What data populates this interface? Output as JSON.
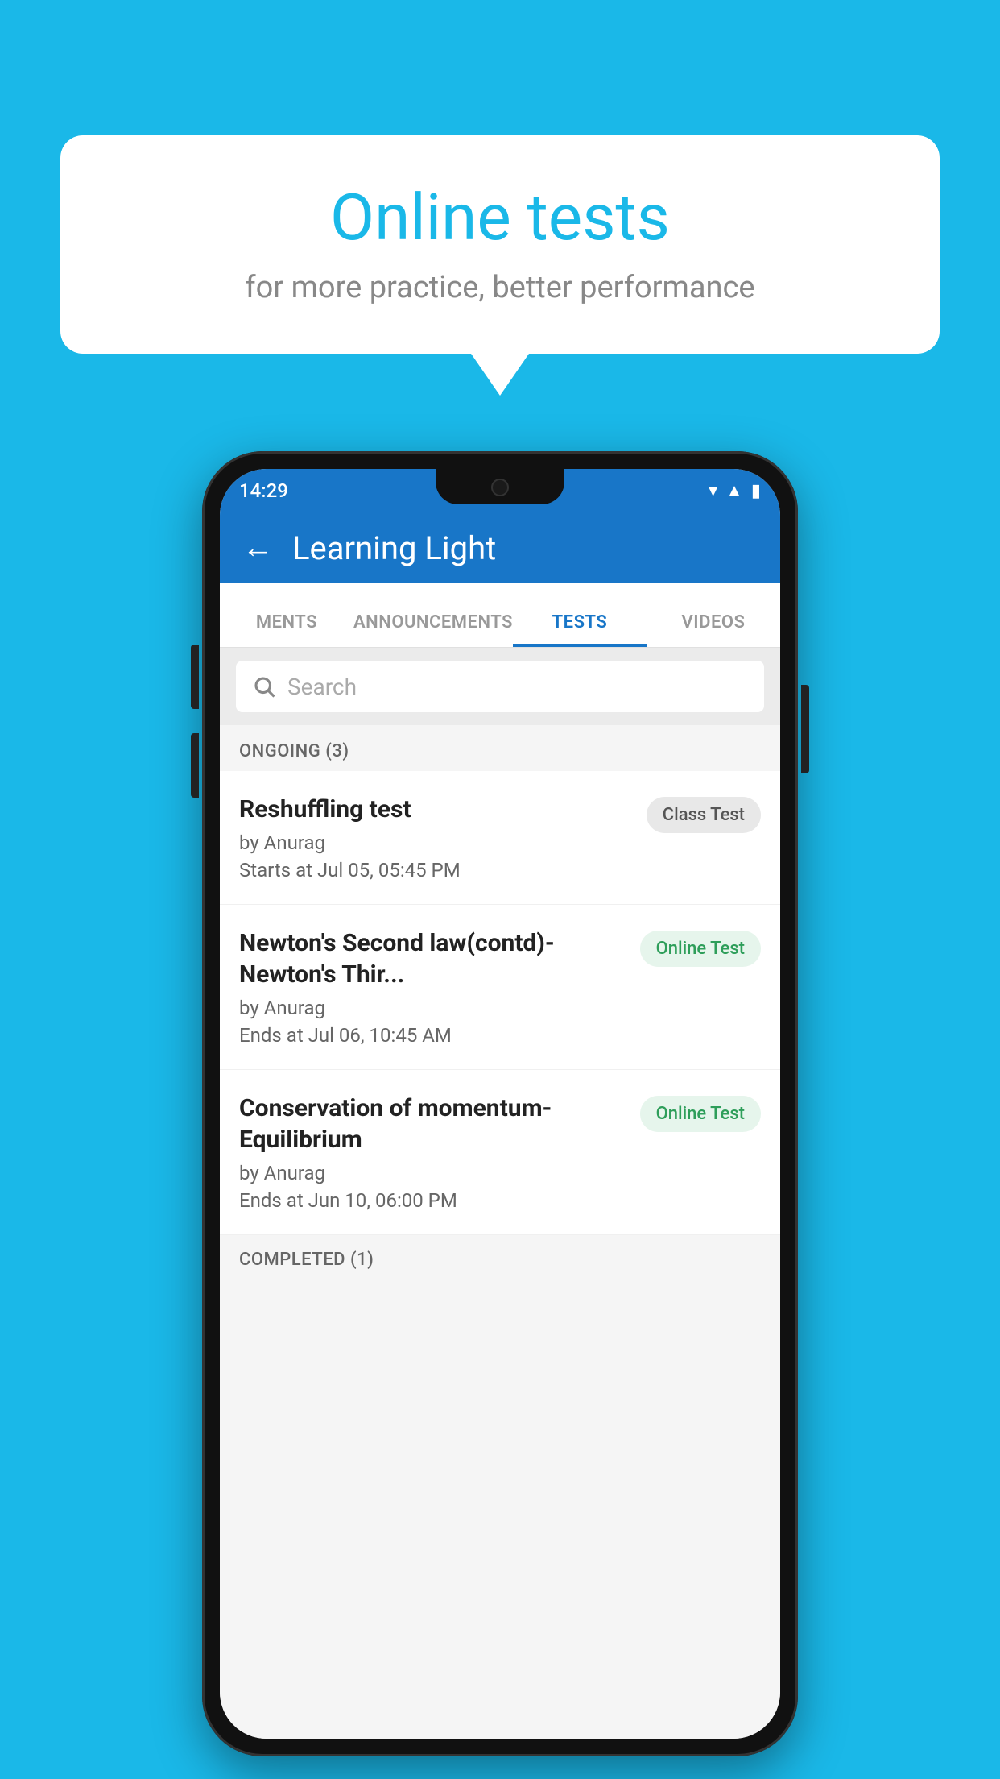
{
  "background_color": "#1ab8e8",
  "bubble": {
    "title": "Online tests",
    "subtitle": "for more practice, better performance"
  },
  "phone": {
    "status_bar": {
      "time": "14:29",
      "icons": [
        "wifi",
        "signal",
        "battery"
      ]
    },
    "app_bar": {
      "title": "Learning Light",
      "back_label": "←"
    },
    "tabs": [
      {
        "label": "MENTS",
        "active": false
      },
      {
        "label": "ANNOUNCEMENTS",
        "active": false
      },
      {
        "label": "TESTS",
        "active": true
      },
      {
        "label": "VIDEOS",
        "active": false
      }
    ],
    "search": {
      "placeholder": "Search"
    },
    "ongoing_section": {
      "header": "ONGOING (3)",
      "items": [
        {
          "title": "Reshuffling test",
          "author": "by Anurag",
          "date": "Starts at  Jul 05, 05:45 PM",
          "badge": "Class Test",
          "badge_type": "class"
        },
        {
          "title": "Newton's Second law(contd)-Newton's Thir...",
          "author": "by Anurag",
          "date": "Ends at  Jul 06, 10:45 AM",
          "badge": "Online Test",
          "badge_type": "online"
        },
        {
          "title": "Conservation of momentum-Equilibrium",
          "author": "by Anurag",
          "date": "Ends at  Jun 10, 06:00 PM",
          "badge": "Online Test",
          "badge_type": "online"
        }
      ]
    },
    "completed_section": {
      "header": "COMPLETED (1)"
    }
  }
}
